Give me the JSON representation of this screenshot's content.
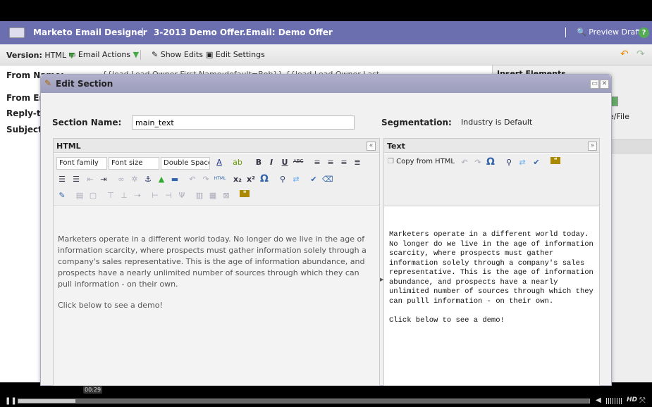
{
  "header": {
    "app_title": "Marketo Email Designer",
    "separator": "|",
    "document_title": "3-2013 Demo Offer.Email: Demo Offer",
    "preview_label": "Preview Draft",
    "help_icon": "?"
  },
  "toolbar": {
    "version_label": "Version:",
    "version_value": "HTML",
    "email_actions": "Email Actions",
    "show_edits": "Show Edits",
    "edit_settings": "Edit Settings"
  },
  "background_form": {
    "from_name": "From Name:",
    "from_name_value": "{{lead.Lead Owner First Name:default=Bob}} {{lead.Lead Owner Last",
    "from_email": "From Em",
    "reply_to": "Reply-to",
    "subject": "Subject:",
    "insert_elements": "Insert Elements",
    "image_file": "e/File"
  },
  "dialog": {
    "title": "Edit Section",
    "section_name_label": "Section Name:",
    "section_name_value": "main_text",
    "segmentation_label": "Segmentation:",
    "segmentation_value": "Industry is Default",
    "html_panel": {
      "title": "HTML",
      "collapse": "«",
      "font_family": "Font family",
      "font_size": "Font size",
      "line_spacing": "Double Space",
      "paragraphs": [
        "Marketers operate in a different world today. No longer do we live in the age of information scarcity, where prospects must gather information solely through a company's sales representative. This is the age of information abundance, and prospects have a nearly unlimited number of sources through which they can pull information - on their own.",
        "Click below to see a demo!"
      ]
    },
    "text_panel": {
      "title": "Text",
      "expand": "»",
      "copy_from_html": "Copy from HTML",
      "content": "Marketers operate in a different world today.\nNo longer do we live in the age of information\nscarcity, where prospects must gather\ninformation solely through a company's sales\nrepresentative. This is the age of information\nabundance, and prospects have a nearly\nunlimited number of sources through which they\ncan pulll information - on their own.\n\nClick below to see a demo!"
    }
  },
  "player": {
    "time_tooltip": "00:29",
    "progress_fraction": 0.1,
    "hd_label": "HD"
  }
}
